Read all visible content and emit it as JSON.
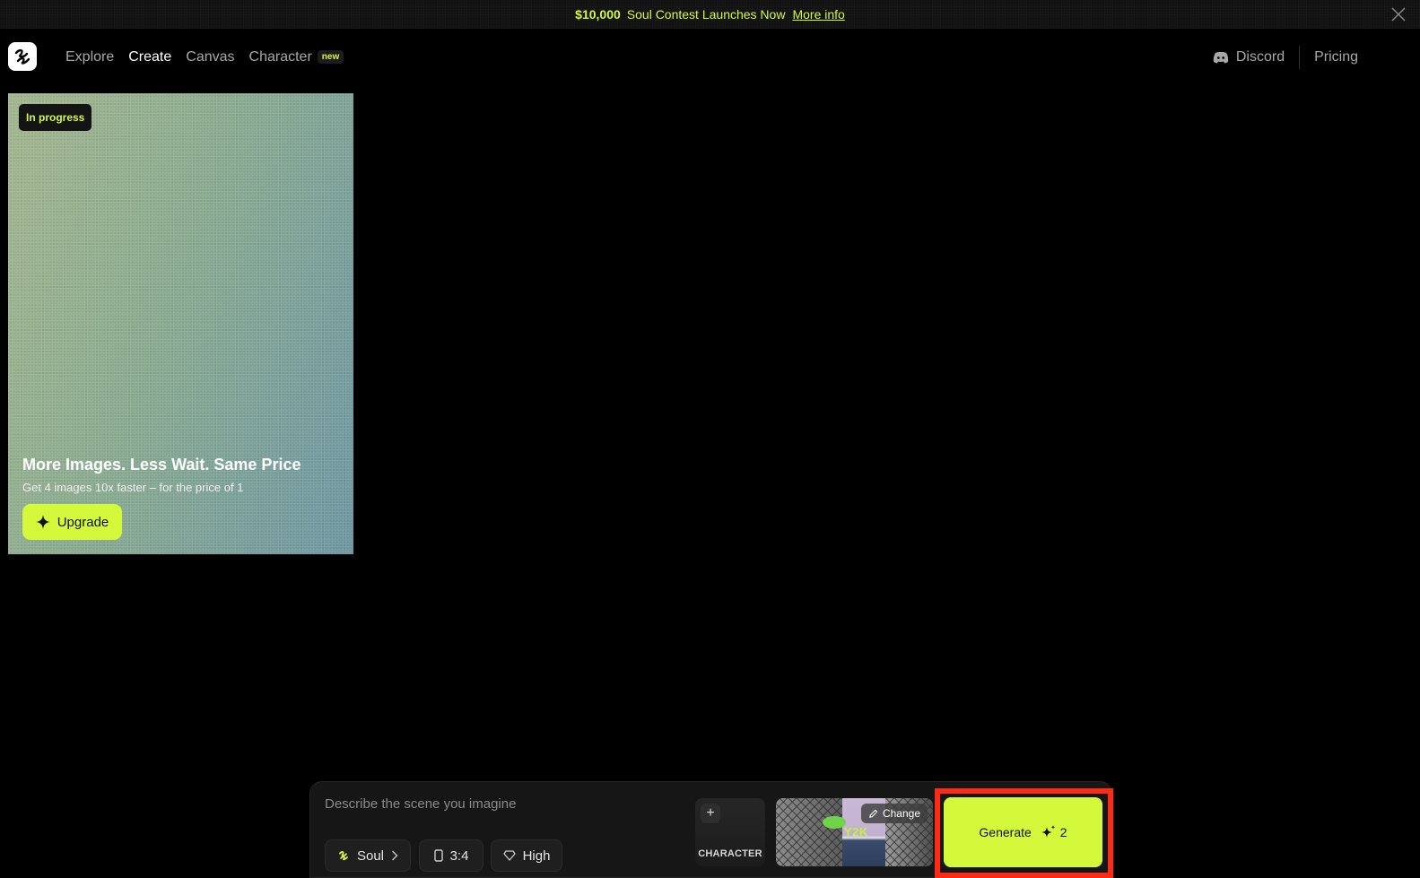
{
  "announcement": {
    "amount": "$10,000",
    "text": "Soul Contest Launches Now",
    "link": "More info"
  },
  "nav": {
    "links": [
      "Explore",
      "Create",
      "Canvas",
      "Character"
    ],
    "active": "Create",
    "badge": "new",
    "discord": "Discord",
    "pricing": "Pricing"
  },
  "card": {
    "status": "In progress",
    "title": "More Images. Less Wait. Same Price",
    "subtitle": "Get 4 images 10x faster – for the price of 1",
    "upgrade_label": "Upgrade"
  },
  "prompt": {
    "placeholder": "Describe the scene you imagine",
    "model": "Soul",
    "ratio": "3:4",
    "quality": "High",
    "character_label": "CHARACTER",
    "style_label": "Y2K",
    "change_label": "Change",
    "generate_label": "Generate",
    "generate_cost": "2"
  },
  "colors": {
    "accent": "#d4f93b",
    "highlight": "#ff2a13"
  }
}
